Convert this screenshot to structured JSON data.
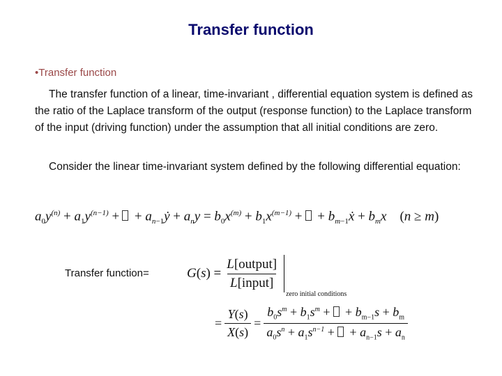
{
  "slide": {
    "title": "Transfer function",
    "bullet": "•Transfer function",
    "paragraph1": "The transfer function of a linear, time-invariant , differential equation system is defined as the ratio of the Laplace transform of the output (response function) to the Laplace transform of the input (driving function) under the assumption that all initial conditions are zero.",
    "paragraph2": "Consider the linear time-invariant system defined by the following differential equation:",
    "differential_equation": {
      "lhs": [
        "a0 y^(n)",
        "a1 y^(n-1)",
        "…",
        "a(n-1) y'",
        "an y"
      ],
      "rhs": [
        "b0 x^(m)",
        "b1 x^(m-1)",
        "…",
        "b(m-1) x'",
        "bm x"
      ],
      "condition": "(n ≥ m)"
    },
    "transfer_label": "Transfer function=",
    "g_def": {
      "lhs": "G(s)",
      "numerator": "L[output]",
      "denominator": "L[input]",
      "subscript": "zero initial conditions"
    },
    "ratio": {
      "numerator": "Y(s)",
      "denominator": "X(s)",
      "poly_numerator": "b0 s^m + b1 s^m + … + b(m-1) s + bm",
      "poly_denominator": "a0 s^n + a1 s^(n-1) + … + a(n-1) s + an"
    }
  }
}
